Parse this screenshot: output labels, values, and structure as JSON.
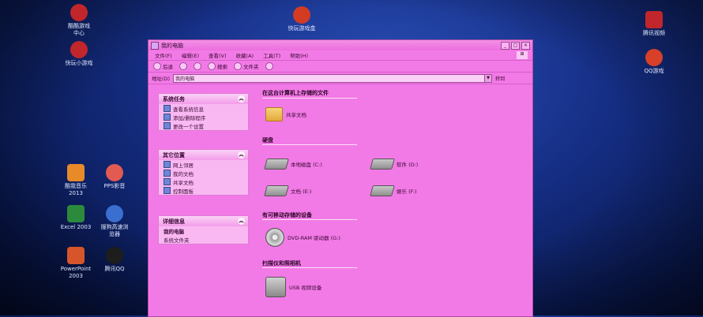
{
  "desktop_icons": [
    {
      "name": "desktop-icon-kuwo-game-center",
      "label": "酷酷游戏\n中心",
      "color": "#c0262b"
    },
    {
      "name": "desktop-icon-kuaiwan-mini",
      "label": "快玩小游戏",
      "color": "#c0262b"
    },
    {
      "name": "desktop-icon-kuaiwan-top",
      "label": "快玩游戏盒",
      "color": "#d33b22"
    },
    {
      "name": "desktop-icon-kugou-music",
      "label": "酷我音乐\n2013",
      "color": "#e8892a"
    },
    {
      "name": "desktop-icon-pps",
      "label": "PPS影音",
      "color": "#e25a52"
    },
    {
      "name": "desktop-icon-excel",
      "label": "Excel 2003",
      "color": "#2c8a3c"
    },
    {
      "name": "desktop-icon-sogou",
      "label": "搜狗高速浏\n览器",
      "color": "#3a6fd0"
    },
    {
      "name": "desktop-icon-powerpoint",
      "label": "PowerPoint\n2003",
      "color": "#d6552a"
    },
    {
      "name": "desktop-icon-qq",
      "label": "腾讯QQ",
      "color": "#1d1d1d"
    },
    {
      "name": "desktop-icon-right-1",
      "label": "腾讯视频",
      "color": "#c0262b"
    },
    {
      "name": "desktop-icon-right-2",
      "label": "QQ游戏",
      "color": "#d8402a"
    }
  ],
  "window": {
    "title": "我的电脑",
    "menu": [
      "文件(F)",
      "编辑(E)",
      "查看(V)",
      "收藏(A)",
      "工具(T)",
      "帮助(H)"
    ],
    "toolbar": {
      "back": "后退",
      "search": "搜索",
      "folders": "文件夹"
    },
    "address_label": "地址(D)",
    "address_value": "我的电脑",
    "go_label": "转到"
  },
  "left_pane": {
    "system_tasks": {
      "title": "系统任务",
      "items": [
        "查看系统信息",
        "添加/删除程序",
        "更改一个设置"
      ]
    },
    "other_places": {
      "title": "其它位置",
      "items": [
        "网上邻居",
        "我的文档",
        "共享文档",
        "控制面板"
      ]
    },
    "details": {
      "title": "详细信息",
      "line1": "我的电脑",
      "line2": "系统文件夹"
    }
  },
  "main": {
    "section_files": "在这台计算机上存储的文件",
    "shared_docs": "共享文档",
    "section_drives": "硬盘",
    "drives": [
      "本地磁盘 (C:)",
      "软件 (D:)",
      "文档 (E:)",
      "娱乐 (F:)"
    ],
    "section_removable": "有可移动存储的设备",
    "dvd": "DVD-RAM 驱动器 (G:)",
    "section_scanners": "扫描仪和照相机",
    "camera": "USB 视频设备"
  }
}
